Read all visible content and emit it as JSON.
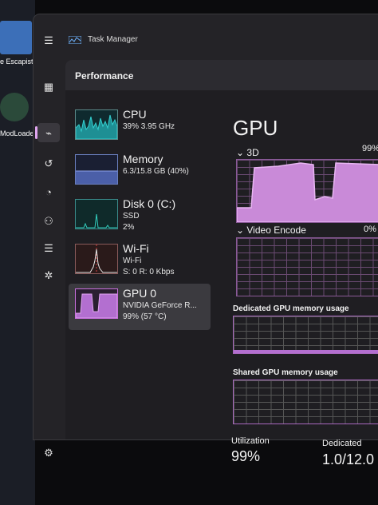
{
  "desktop": {
    "icon1_label": "e Escapist",
    "icon2_label": "ModLoade"
  },
  "window": {
    "title": "Task Manager"
  },
  "sidebar": {
    "icons": [
      "hamburger-icon",
      "processes-icon",
      "performance-icon",
      "app-history-icon",
      "startup-icon",
      "users-icon",
      "details-icon",
      "services-icon",
      "settings-icon"
    ]
  },
  "performance": {
    "heading": "Performance",
    "items": [
      {
        "name": "CPU",
        "line1": "39%  3.95 GHz",
        "line2": ""
      },
      {
        "name": "Memory",
        "line1": "6.3/15.8 GB (40%)",
        "line2": ""
      },
      {
        "name": "Disk 0 (C:)",
        "line1": "SSD",
        "line2": "2%"
      },
      {
        "name": "Wi-Fi",
        "line1": "Wi-Fi",
        "line2": "S: 0 R: 0 Kbps"
      },
      {
        "name": "GPU 0",
        "line1": "NVIDIA GeForce R...",
        "line2": "99%  (57 °C)"
      }
    ]
  },
  "detail": {
    "title": "GPU",
    "engine1": "3D",
    "engine1_pct": "99%",
    "engine2": "Video Encode",
    "engine2_pct": "0%",
    "dedicated_label": "Dedicated GPU memory usage",
    "shared_label": "Shared GPU memory usage",
    "utilization_label": "Utilization",
    "utilization_value": "99%",
    "dedicated_mem_label": "Dedicated",
    "dedicated_mem_value": "1.0/12.0"
  },
  "colors": {
    "gpu_accent": "#c86fdc",
    "cpu_accent": "#2bb5b5"
  }
}
